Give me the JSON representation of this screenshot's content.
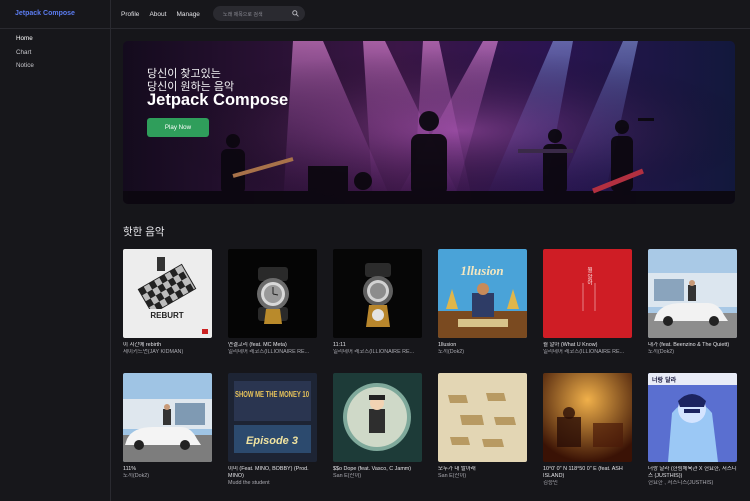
{
  "app": {
    "brand": "Jetpack Compose"
  },
  "sidebar": {
    "items": [
      {
        "label": "Home"
      },
      {
        "label": "Chart"
      },
      {
        "label": "Notice"
      }
    ]
  },
  "nav": {
    "items": [
      {
        "label": "Profile"
      },
      {
        "label": "About"
      },
      {
        "label": "Manage"
      }
    ]
  },
  "search": {
    "placeholder": "노래 제목으로 검색",
    "icon": "search-icon"
  },
  "hero": {
    "subtitle_line1": "당신이 찾고있는",
    "subtitle_line2": "당신이 원하는 음악",
    "title": "Jetpack Compose",
    "button_label": "Play Now",
    "button_color": "#2f9e5b"
  },
  "section": {
    "title": "핫한 음악"
  },
  "songs": [
    {
      "title": "이 시간에 rebirth",
      "artist": "제이키드먼(JAY KIDMAN)",
      "cover_text": "REBURT",
      "cover_color": "#e8e8e8"
    },
    {
      "title": "연결고리 (feat. MC Meta)",
      "artist": "일리네어 레코즈(ILLIONAIRE RE...",
      "cover_color": "#050505"
    },
    {
      "title": "11:11",
      "artist": "일리네어 레코즈(ILLIONAIRE RE...",
      "cover_color": "#060606"
    },
    {
      "title": "1llusion",
      "artist": "도끼(Dok2)",
      "cover_text": "1llusion",
      "cover_color": "#4aa3d8"
    },
    {
      "title": "뭘 알아 (What U Know)",
      "artist": "일리네어 레코즈(ILLIONAIRE RE...",
      "cover_text": "뭘 알아",
      "cover_color": "#cf1d25"
    },
    {
      "title": "내가 (feat. Beenzino & The Quiett)",
      "artist": "도끼(Dok2)",
      "cover_color": "#a9c9e6"
    },
    {
      "title": "111%",
      "artist": "도끼(Dok2)",
      "cover_color": "#9fc4e4"
    },
    {
      "title": "이미 (Feat. MINO, BOBBY) (Prod. MINO)",
      "artist": "Mudd the student",
      "cover_text": "SHOW ME THE MONEY 10",
      "cover_text2": "Episode 3",
      "cover_color": "#1d2434"
    },
    {
      "title": "$$o Dope (feat. Vasco, C Jamm)",
      "artist": "San E(산이)",
      "cover_color": "#1d3b38"
    },
    {
      "title": "모두가 내 발아래",
      "artist": "San E(산이)",
      "cover_color": "#e3d6b4"
    },
    {
      "title": "10°0' 0\" N 118°50 0\" E (feat. ASH ISLAND)",
      "artist": "김승민",
      "cover_color": "#7a2a0e"
    },
    {
      "title": "너랑 달라 (한림체육관 X 헌요한, 저스디스 (JUSTHIS))",
      "artist": "헌요한 , 저스디스(JUSTHIS)",
      "cover_text": "너랑 달라",
      "cover_color": "#5a6fd0"
    }
  ]
}
